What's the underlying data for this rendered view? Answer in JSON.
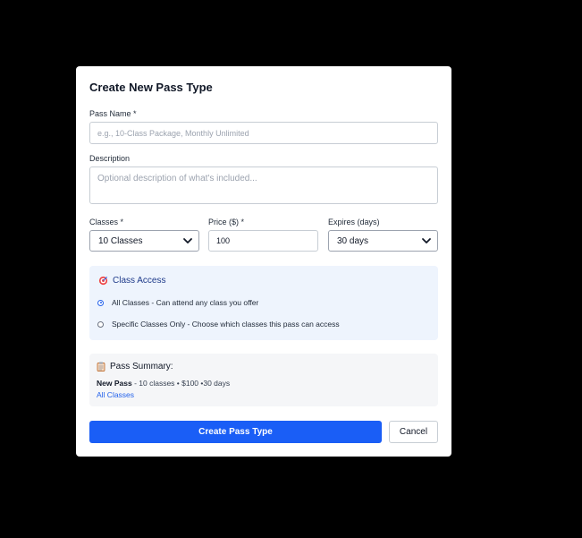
{
  "dialog": {
    "title": "Create New Pass Type",
    "pass_name": {
      "label": "Pass Name *",
      "value": "",
      "placeholder": "e.g., 10-Class Package, Monthly Unlimited"
    },
    "description": {
      "label": "Description",
      "value": "",
      "placeholder": "Optional description of what's included..."
    },
    "classes": {
      "label": "Classes *",
      "selected": "10 Classes"
    },
    "price": {
      "label": "Price ($) *",
      "value": "100"
    },
    "expires": {
      "label": "Expires (days)",
      "selected": "30 days"
    },
    "class_access": {
      "heading": "Class Access",
      "options": [
        {
          "label": "All Classes - Can attend any class you offer",
          "selected": true
        },
        {
          "label": "Specific Classes Only - Choose which classes this pass can access",
          "selected": false
        }
      ]
    },
    "summary": {
      "heading": "Pass Summary:",
      "name": "New Pass",
      "details": " - 10 classes • $100 •30 days",
      "access": "All Classes"
    },
    "buttons": {
      "create": "Create Pass Type",
      "cancel": "Cancel"
    }
  },
  "colors": {
    "primary": "#1a5ef6",
    "access_bg": "#eef4fd",
    "summary_bg": "#f5f6f8",
    "link": "#2563eb",
    "backdrop": "#000000"
  }
}
